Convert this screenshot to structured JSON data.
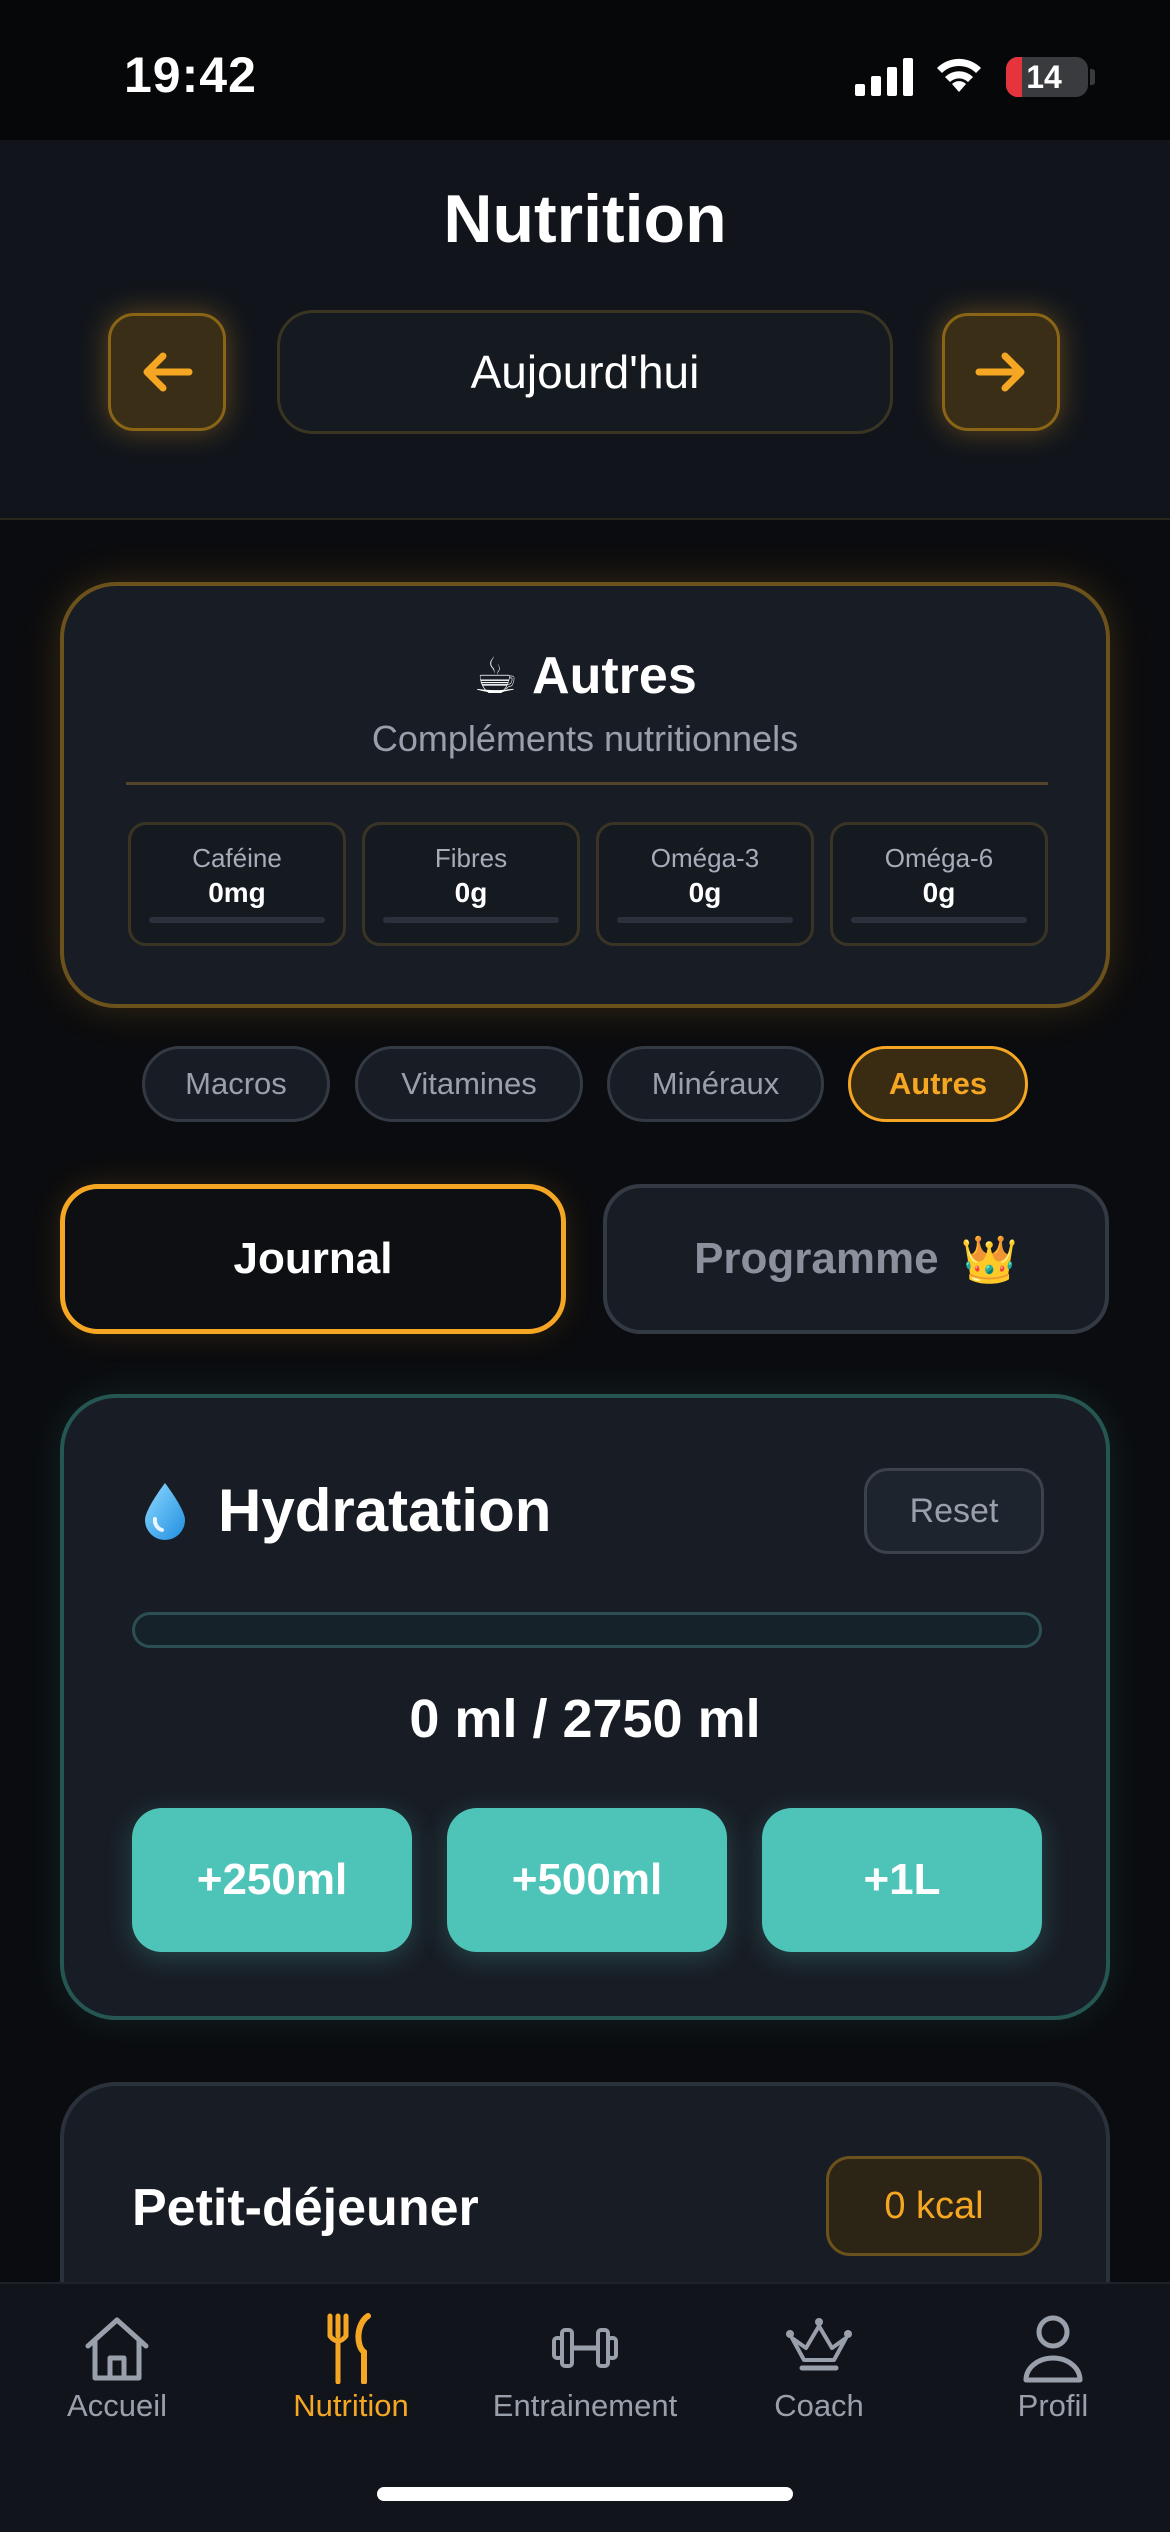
{
  "status_bar": {
    "time": "19:42",
    "battery": "14",
    "battery_color": "#e5343b"
  },
  "header": {
    "title": "Nutrition",
    "prev_icon": "arrow-left-icon",
    "next_icon": "arrow-right-icon",
    "date_label": "Aujourd'hui"
  },
  "nutrient_card": {
    "emoji": "☕",
    "title": "Autres",
    "subtitle": "Compléments nutritionnels",
    "items": [
      {
        "name": "Caféine",
        "value": "0mg"
      },
      {
        "name": "Fibres",
        "value": "0g"
      },
      {
        "name": "Oméga-3",
        "value": "0g"
      },
      {
        "name": "Oméga-6",
        "value": "0g"
      }
    ]
  },
  "category_tabs": [
    {
      "label": "Macros",
      "active": false
    },
    {
      "label": "Vitamines",
      "active": false
    },
    {
      "label": "Minéraux",
      "active": false
    },
    {
      "label": "Autres",
      "active": true
    }
  ],
  "mode_switch": {
    "journal_label": "Journal",
    "programme_label": "Programme",
    "programme_emoji": "👑",
    "active": "journal"
  },
  "hydration": {
    "icon": "water-drop-icon",
    "title": "Hydratation",
    "reset_label": "Reset",
    "progress_fraction": 0,
    "amount_text": "0 ml / 2750 ml",
    "buttons": [
      "+250ml",
      "+500ml",
      "+1L"
    ],
    "accent_color": "#4ec4b8"
  },
  "meal": {
    "title": "Petit-déjeuner",
    "kcal": "0 kcal"
  },
  "tab_bar": [
    {
      "label": "Accueil",
      "icon": "home-icon",
      "active": false
    },
    {
      "label": "Nutrition",
      "icon": "fork-knife-icon",
      "active": true
    },
    {
      "label": "Entrainement",
      "icon": "dumbbell-icon",
      "active": false
    },
    {
      "label": "Coach",
      "icon": "crown-icon",
      "active": false
    },
    {
      "label": "Profil",
      "icon": "person-icon",
      "active": false
    }
  ],
  "colors": {
    "accent": "#f5a623",
    "background": "#0b0c0f",
    "card": "#181d25"
  }
}
